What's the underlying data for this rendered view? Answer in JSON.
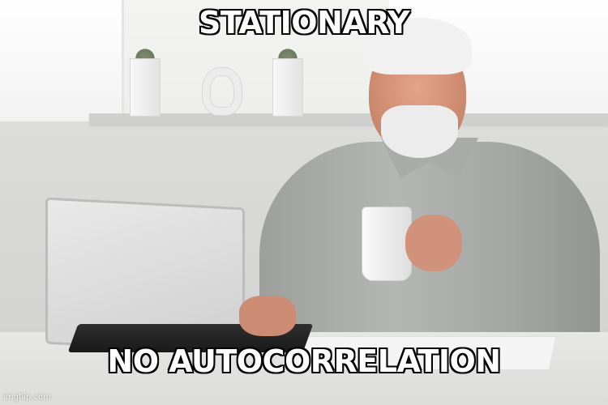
{
  "meme": {
    "top_text": "STATIONARY",
    "bottom_text": "NO AUTOCORRELATION",
    "watermark": "imgflip.com"
  },
  "colors": {
    "caption_fill": "#ffffff",
    "caption_outline": "#000000"
  }
}
